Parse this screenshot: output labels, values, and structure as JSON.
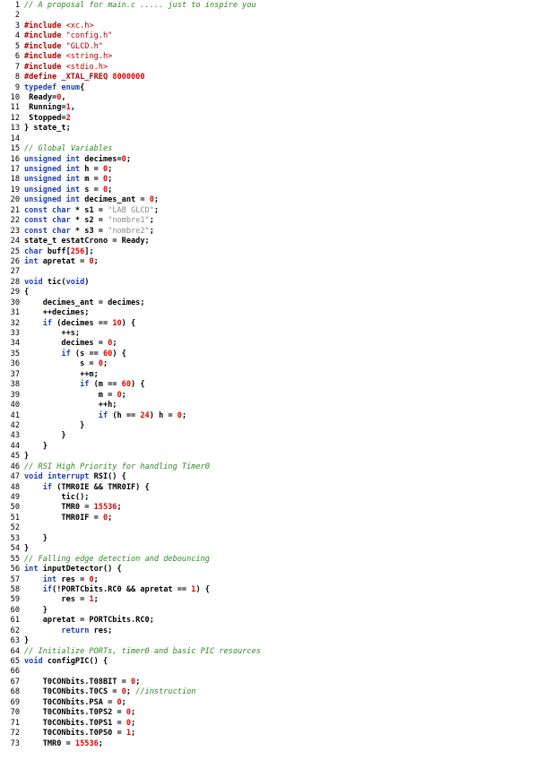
{
  "code_view": {
    "lines": [
      {
        "n": "1",
        "tokens": [
          [
            "cm",
            "// A proposal for main.c ..... just to inspire you"
          ]
        ]
      },
      {
        "n": "2",
        "tokens": []
      },
      {
        "n": "3",
        "tokens": [
          [
            "pp",
            "#include "
          ],
          [
            "str",
            "<xc.h>"
          ]
        ]
      },
      {
        "n": "4",
        "tokens": [
          [
            "pp",
            "#include "
          ],
          [
            "str",
            "\"config.h\""
          ]
        ]
      },
      {
        "n": "5",
        "tokens": [
          [
            "pp",
            "#include "
          ],
          [
            "str",
            "\"GLCD.h\""
          ]
        ]
      },
      {
        "n": "6",
        "tokens": [
          [
            "pp",
            "#include "
          ],
          [
            "str",
            "<string.h>"
          ]
        ]
      },
      {
        "n": "7",
        "tokens": [
          [
            "pp",
            "#include "
          ],
          [
            "str",
            "<stdio.h>"
          ]
        ]
      },
      {
        "n": "8",
        "tokens": [
          [
            "pp",
            "#define _XTAL_FREQ "
          ],
          [
            "num",
            "8000000"
          ]
        ]
      },
      {
        "n": "9",
        "tokens": [
          [
            "kw",
            "typedef enum"
          ],
          [
            "pl",
            "{"
          ]
        ]
      },
      {
        "n": "10",
        "tokens": [
          [
            "pl",
            " Ready="
          ],
          [
            "num",
            "0"
          ],
          [
            "pl",
            ","
          ]
        ]
      },
      {
        "n": "11",
        "tokens": [
          [
            "pl",
            " Running="
          ],
          [
            "num",
            "1"
          ],
          [
            "pl",
            ","
          ]
        ]
      },
      {
        "n": "12",
        "tokens": [
          [
            "pl",
            " Stopped="
          ],
          [
            "num",
            "2"
          ]
        ]
      },
      {
        "n": "13",
        "tokens": [
          [
            "pl",
            "} state_t;"
          ]
        ]
      },
      {
        "n": "14",
        "tokens": []
      },
      {
        "n": "15",
        "tokens": [
          [
            "cm",
            "// Global Variables"
          ]
        ]
      },
      {
        "n": "16",
        "tokens": [
          [
            "kw",
            "unsigned int"
          ],
          [
            "pl",
            " decimes="
          ],
          [
            "num",
            "0"
          ],
          [
            "pl",
            ";"
          ]
        ]
      },
      {
        "n": "17",
        "tokens": [
          [
            "kw",
            "unsigned int"
          ],
          [
            "pl",
            " h = "
          ],
          [
            "num",
            "0"
          ],
          [
            "pl",
            ";"
          ]
        ]
      },
      {
        "n": "18",
        "tokens": [
          [
            "kw",
            "unsigned int"
          ],
          [
            "pl",
            " m = "
          ],
          [
            "num",
            "0"
          ],
          [
            "pl",
            ";"
          ]
        ]
      },
      {
        "n": "19",
        "tokens": [
          [
            "kw",
            "unsigned int"
          ],
          [
            "pl",
            " s = "
          ],
          [
            "num",
            "0"
          ],
          [
            "pl",
            ";"
          ]
        ]
      },
      {
        "n": "20",
        "tokens": [
          [
            "kw",
            "unsigned int"
          ],
          [
            "pl",
            " decimes_ant = "
          ],
          [
            "num",
            "0"
          ],
          [
            "pl",
            ";"
          ]
        ]
      },
      {
        "n": "21",
        "tokens": [
          [
            "kw",
            "const char"
          ],
          [
            "pl",
            " * s1 = "
          ],
          [
            "sstr",
            "\"LAB GLCD\""
          ],
          [
            "pl",
            ";"
          ]
        ]
      },
      {
        "n": "22",
        "tokens": [
          [
            "kw",
            "const char"
          ],
          [
            "pl",
            " * s2 = "
          ],
          [
            "sstr",
            "\"nombre1\""
          ],
          [
            "pl",
            ";"
          ]
        ]
      },
      {
        "n": "23",
        "tokens": [
          [
            "kw",
            "const char"
          ],
          [
            "pl",
            " * s3 = "
          ],
          [
            "sstr",
            "\"nombre2\""
          ],
          [
            "pl",
            ";"
          ]
        ]
      },
      {
        "n": "24",
        "tokens": [
          [
            "pl",
            "state_t estatCrono = Ready;"
          ]
        ]
      },
      {
        "n": "25",
        "tokens": [
          [
            "kw",
            "char"
          ],
          [
            "pl",
            " buff["
          ],
          [
            "num",
            "256"
          ],
          [
            "pl",
            "];"
          ]
        ]
      },
      {
        "n": "26",
        "tokens": [
          [
            "kw",
            "int"
          ],
          [
            "pl",
            " apretat = "
          ],
          [
            "num",
            "0"
          ],
          [
            "pl",
            ";"
          ]
        ]
      },
      {
        "n": "27",
        "tokens": []
      },
      {
        "n": "28",
        "tokens": [
          [
            "kw",
            "void"
          ],
          [
            "pl",
            " tic("
          ],
          [
            "kw",
            "void"
          ],
          [
            "pl",
            ")"
          ]
        ]
      },
      {
        "n": "29",
        "tokens": [
          [
            "pl",
            "{"
          ]
        ]
      },
      {
        "n": "30",
        "tokens": [
          [
            "pl",
            "    decimes_ant = decimes;"
          ]
        ]
      },
      {
        "n": "31",
        "tokens": [
          [
            "pl",
            "    ++decimes;"
          ]
        ]
      },
      {
        "n": "32",
        "tokens": [
          [
            "kw",
            "    if"
          ],
          [
            "pl",
            " (decimes == "
          ],
          [
            "num",
            "10"
          ],
          [
            "pl",
            ") {"
          ]
        ]
      },
      {
        "n": "33",
        "tokens": [
          [
            "pl",
            "        ++s;"
          ]
        ]
      },
      {
        "n": "34",
        "tokens": [
          [
            "pl",
            "        decimes = "
          ],
          [
            "num",
            "0"
          ],
          [
            "pl",
            ";"
          ]
        ]
      },
      {
        "n": "35",
        "tokens": [
          [
            "kw",
            "        if"
          ],
          [
            "pl",
            " (s == "
          ],
          [
            "num",
            "60"
          ],
          [
            "pl",
            ") {"
          ]
        ]
      },
      {
        "n": "36",
        "tokens": [
          [
            "pl",
            "            s = "
          ],
          [
            "num",
            "0"
          ],
          [
            "pl",
            ";"
          ]
        ]
      },
      {
        "n": "37",
        "tokens": [
          [
            "pl",
            "            ++m;"
          ]
        ]
      },
      {
        "n": "38",
        "tokens": [
          [
            "kw",
            "            if"
          ],
          [
            "pl",
            " (m == "
          ],
          [
            "num",
            "60"
          ],
          [
            "pl",
            ") {"
          ]
        ]
      },
      {
        "n": "39",
        "tokens": [
          [
            "pl",
            "                m = "
          ],
          [
            "num",
            "0"
          ],
          [
            "pl",
            ";"
          ]
        ]
      },
      {
        "n": "40",
        "tokens": [
          [
            "pl",
            "                ++h;"
          ]
        ]
      },
      {
        "n": "41",
        "tokens": [
          [
            "kw",
            "                if"
          ],
          [
            "pl",
            " (h == "
          ],
          [
            "num",
            "24"
          ],
          [
            "pl",
            ") h = "
          ],
          [
            "num",
            "0"
          ],
          [
            "pl",
            ";"
          ]
        ]
      },
      {
        "n": "42",
        "tokens": [
          [
            "pl",
            "            }"
          ]
        ]
      },
      {
        "n": "43",
        "tokens": [
          [
            "pl",
            "        }"
          ]
        ]
      },
      {
        "n": "44",
        "tokens": [
          [
            "pl",
            "    }"
          ]
        ]
      },
      {
        "n": "45",
        "tokens": [
          [
            "pl",
            "}"
          ]
        ]
      },
      {
        "n": "46",
        "tokens": [
          [
            "cm",
            "// RSI High Priority for handling Timer0"
          ]
        ]
      },
      {
        "n": "47",
        "tokens": [
          [
            "kw",
            "void interrupt"
          ],
          [
            "pl",
            " RSI() {"
          ]
        ]
      },
      {
        "n": "48",
        "tokens": [
          [
            "kw",
            "    if"
          ],
          [
            "pl",
            " (TMR0IE && TMR0IF) {"
          ]
        ]
      },
      {
        "n": "49",
        "tokens": [
          [
            "pl",
            "        tic();"
          ]
        ]
      },
      {
        "n": "50",
        "tokens": [
          [
            "pl",
            "        TMR0 = "
          ],
          [
            "num",
            "15536"
          ],
          [
            "pl",
            ";"
          ]
        ]
      },
      {
        "n": "51",
        "tokens": [
          [
            "pl",
            "        TMR0IF = "
          ],
          [
            "num",
            "0"
          ],
          [
            "pl",
            ";"
          ]
        ]
      },
      {
        "n": "52",
        "tokens": []
      },
      {
        "n": "53",
        "tokens": [
          [
            "pl",
            "    }"
          ]
        ]
      },
      {
        "n": "54",
        "tokens": [
          [
            "pl",
            "}"
          ]
        ]
      },
      {
        "n": "55",
        "tokens": [
          [
            "cm",
            "// Falling edge detection and debouncing"
          ]
        ]
      },
      {
        "n": "56",
        "tokens": [
          [
            "kw",
            "int"
          ],
          [
            "pl",
            " inputDetector() {"
          ]
        ]
      },
      {
        "n": "57",
        "tokens": [
          [
            "kw",
            "    int"
          ],
          [
            "pl",
            " res = "
          ],
          [
            "num",
            "0"
          ],
          [
            "pl",
            ";"
          ]
        ]
      },
      {
        "n": "58",
        "tokens": [
          [
            "kw",
            "    if"
          ],
          [
            "pl",
            "(!PORTCbits.RC0 && apretat == "
          ],
          [
            "num",
            "1"
          ],
          [
            "pl",
            ") {"
          ]
        ]
      },
      {
        "n": "59",
        "tokens": [
          [
            "pl",
            "        res = "
          ],
          [
            "num",
            "1"
          ],
          [
            "pl",
            ";"
          ]
        ]
      },
      {
        "n": "60",
        "tokens": [
          [
            "pl",
            "    }"
          ]
        ]
      },
      {
        "n": "61",
        "tokens": [
          [
            "pl",
            "    apretat = PORTCbits.RC0;"
          ]
        ]
      },
      {
        "n": "62",
        "tokens": [
          [
            "kw",
            "        return"
          ],
          [
            "pl",
            " res;"
          ]
        ]
      },
      {
        "n": "63",
        "tokens": [
          [
            "pl",
            "}"
          ]
        ]
      },
      {
        "n": "64",
        "tokens": [
          [
            "cm",
            "// Initialize PORTs, timer0 and basic PIC resources"
          ]
        ]
      },
      {
        "n": "65",
        "tokens": [
          [
            "kw",
            "void"
          ],
          [
            "pl",
            " configPIC() {"
          ]
        ]
      },
      {
        "n": "66",
        "tokens": []
      },
      {
        "n": "67",
        "tokens": [
          [
            "pl",
            "    T0CONbits.T08BIT = "
          ],
          [
            "num",
            "0"
          ],
          [
            "pl",
            ";"
          ]
        ]
      },
      {
        "n": "68",
        "tokens": [
          [
            "pl",
            "    T0CONbits.T0CS = "
          ],
          [
            "num",
            "0"
          ],
          [
            "pl",
            "; "
          ],
          [
            "cm",
            "//instruction"
          ]
        ]
      },
      {
        "n": "69",
        "tokens": [
          [
            "pl",
            "    T0CONbits.PSA = "
          ],
          [
            "num",
            "0"
          ],
          [
            "pl",
            ";"
          ]
        ]
      },
      {
        "n": "70",
        "tokens": [
          [
            "pl",
            "    T0CONbits.T0PS2 = "
          ],
          [
            "num",
            "0"
          ],
          [
            "pl",
            ";"
          ]
        ]
      },
      {
        "n": "71",
        "tokens": [
          [
            "pl",
            "    T0CONbits.T0PS1 = "
          ],
          [
            "num",
            "0"
          ],
          [
            "pl",
            ";"
          ]
        ]
      },
      {
        "n": "72",
        "tokens": [
          [
            "pl",
            "    T0CONbits.T0PS0 = "
          ],
          [
            "num",
            "1"
          ],
          [
            "pl",
            ";"
          ]
        ]
      },
      {
        "n": "73",
        "tokens": [
          [
            "pl",
            "    TMR0 = "
          ],
          [
            "num",
            "15536"
          ],
          [
            "pl",
            ";"
          ]
        ]
      }
    ]
  }
}
